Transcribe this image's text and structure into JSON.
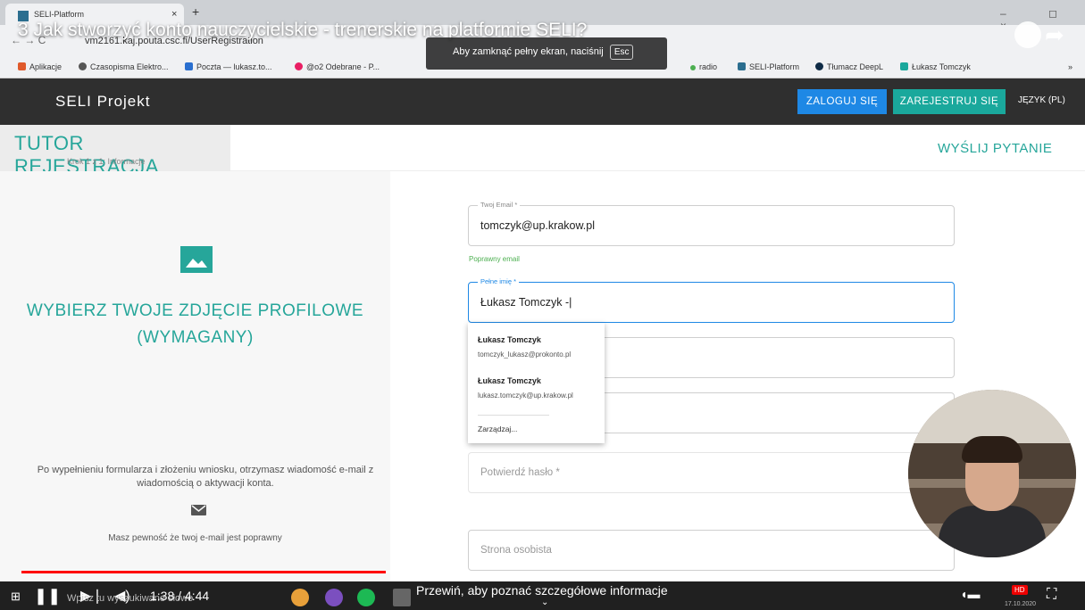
{
  "browser": {
    "tab_title": "SELI-Platform",
    "tab_close": "×",
    "tab_new": "+",
    "nav": "←  →  C",
    "url": "vm2161.kaj.pouta.csc.fi/UserRegistration",
    "bookmarks": [
      "Aplikacje",
      "Czasopisma Elektro...",
      "Poczta — lukasz.to...",
      "@o2 Odebrane - P...",
      "radio",
      "SELI-Platform",
      "Tłumacz DeepL",
      "Łukasz Tomczyk"
    ],
    "bookmarks_more": "»",
    "window_controls": "– ◻ ×"
  },
  "video": {
    "title": "3 Jak stworzyć konto nauczycielskie - trenerskie na platformie SELI?",
    "fullscreen_hint": "Aby zamknąć pełny ekran, naciśnij",
    "esc_key": "Esc",
    "time": "1:38 / 4:44",
    "progress": 0.347,
    "seek_hint": "Przewiń, aby poznać szczegółowe informacje",
    "seek_chevron": "⌄",
    "taskbar_search": "Wpisz tu wyszukiwane słowo",
    "hd": "HD",
    "date": "17.10.2020"
  },
  "app": {
    "brand": "SELI Projekt",
    "login": "ZALOGUJ SIĘ",
    "register": "ZAREJESTRUJ SIĘ",
    "language": "JĘZYK (PL)",
    "page_title": "TUTOR REJESTRACJA",
    "step": "Krok 1 z 1: Informacje",
    "send_question": "WYŚLIJ PYTANIE"
  },
  "left_panel": {
    "photo_title_line1": "WYBIERZ TWOJE ZDJĘCIE PROFILOWE",
    "photo_title_line2": "(WYMAGANY)",
    "info": "Po wypełnieniu formularza i złożeniu wniosku, otrzymasz wiadomość e-mail z wiadomością o aktywacji konta.",
    "sure": "Masz pewność że twoj e-mail jest poprawny"
  },
  "form": {
    "email_label": "Twoj Email *",
    "email_value": "tomczyk@up.krakow.pl",
    "email_helper": "Poprawny email",
    "name_label": "Pełne imię *",
    "name_value": "Łukasz Tomczyk -|",
    "confirm_placeholder": "Potwierdź hasło *",
    "site_placeholder": "Strona osobista"
  },
  "autofill": {
    "items": [
      {
        "name": "Łukasz Tomczyk",
        "email": "tomczyk_lukasz@prokonto.pl"
      },
      {
        "name": "Łukasz Tomczyk",
        "email": "lukasz.tomczyk@up.krakow.pl"
      }
    ],
    "manage": "Zarządzaj..."
  },
  "colors": {
    "teal": "#26a69a",
    "blue": "#1e88e5",
    "header": "#2f2f2f",
    "progress": "#ff0000"
  },
  "icons": [
    "image-icon",
    "mail-icon",
    "play-pause-icon",
    "next-icon",
    "volume-icon",
    "clock-icon",
    "share-icon"
  ]
}
